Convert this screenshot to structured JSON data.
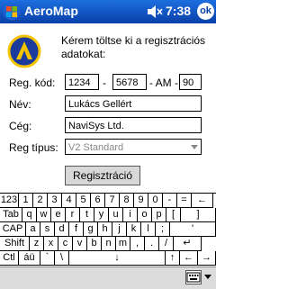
{
  "titlebar": {
    "title": "AeroMap",
    "time": "7:38",
    "ok_label": "ok"
  },
  "intro_text": "Kérem töltse ki a regisztrációs adatokat:",
  "form": {
    "reg_kod_label": "Reg. kód:",
    "reg_kod_1": "1234",
    "sep1": "-",
    "reg_kod_2": "5678",
    "sep2": "- AM -",
    "reg_kod_3": "90",
    "nev_label": "Név:",
    "nev_value": "Lukács Gellért",
    "ceg_label": "Cég:",
    "ceg_value": "NaviSys Ltd.",
    "reg_tipus_label": "Reg típus:",
    "reg_tipus_value": "V2 Standard"
  },
  "register_button": "Regisztráció",
  "keyboard": {
    "row1": [
      "123",
      "1",
      "2",
      "3",
      "4",
      "5",
      "6",
      "7",
      "8",
      "9",
      "0",
      "-",
      "=",
      "←"
    ],
    "row2": [
      "Tab",
      "q",
      "w",
      "e",
      "r",
      "t",
      "y",
      "u",
      "i",
      "o",
      "p",
      "[",
      "]"
    ],
    "row3": [
      "CAP",
      "a",
      "s",
      "d",
      "f",
      "g",
      "h",
      "j",
      "k",
      "l",
      ";",
      "'"
    ],
    "row4": [
      "Shift",
      "z",
      "x",
      "c",
      "v",
      "b",
      "n",
      "m",
      ",",
      ".",
      "/",
      "↵"
    ],
    "row5": [
      "Ctl",
      "áü",
      "`",
      "\\",
      "↓",
      "↑",
      "←",
      "→"
    ]
  },
  "icons": {
    "start": "windows-flag-icon",
    "speaker": "speaker-icon",
    "logo": "aeromap-logo-icon",
    "keyboard": "keyboard-icon"
  }
}
